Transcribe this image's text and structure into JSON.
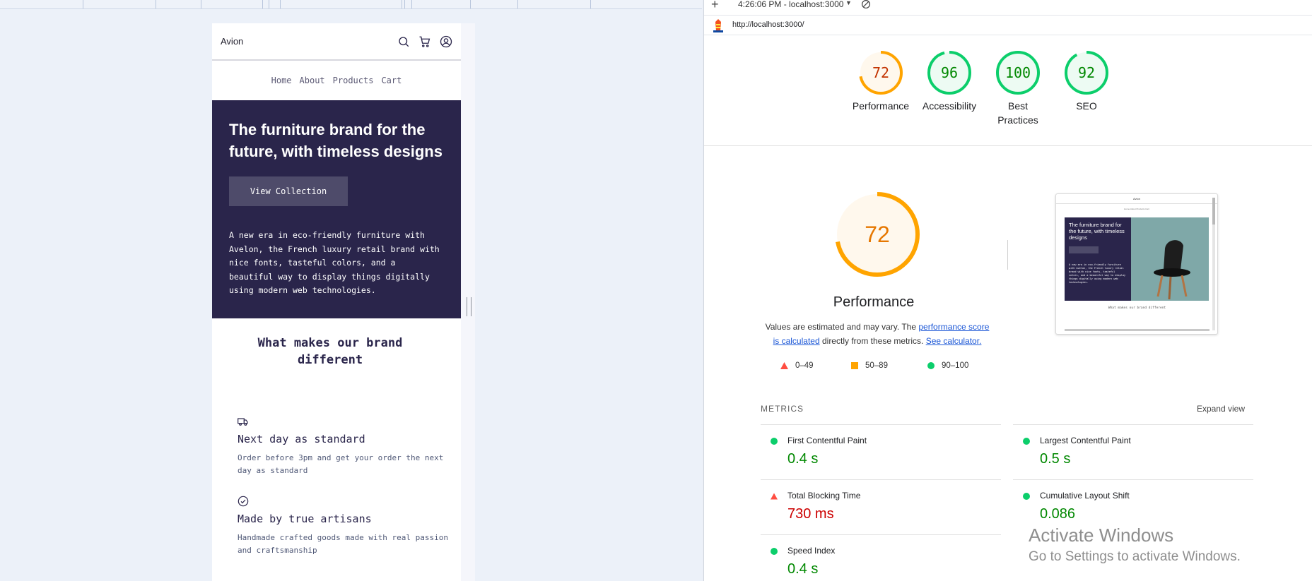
{
  "site": {
    "brand": "Avion",
    "nav": [
      "Home",
      "About",
      "Products",
      "Cart"
    ],
    "hero_title": "The furniture brand for the future, with timeless designs",
    "hero_button": "View Collection",
    "hero_text": "A new era in eco-friendly furniture with Avelon, the French luxury retail brand with nice fonts, tasteful colors, and a beautiful way to display things digitally using modern web technologies.",
    "section_title": "What makes our brand different",
    "features": [
      {
        "icon": "delivery-truck-icon",
        "title": "Next day as standard",
        "text": "Order before 3pm and get your order the next day as standard"
      },
      {
        "icon": "check-circle-icon",
        "title": "Made by true artisans",
        "text": "Handmade crafted goods made with real passion and craftsmanship"
      }
    ]
  },
  "lighthouse": {
    "report_label": "4:26:06 PM - localhost:3000",
    "url": "http://localhost:3000/",
    "categories": [
      {
        "label": "Performance",
        "score": 72,
        "status": "average"
      },
      {
        "label": "Accessibility",
        "score": 96,
        "status": "pass"
      },
      {
        "label": "Best Practices",
        "score": 100,
        "status": "pass"
      },
      {
        "label": "SEO",
        "score": 92,
        "status": "pass"
      }
    ],
    "performance": {
      "score": 72,
      "title": "Performance",
      "desc_pre": "Values are estimated and may vary. The ",
      "desc_link1": "performance score is calculated",
      "desc_mid": " directly from these metrics. ",
      "desc_link2": "See calculator."
    },
    "legend": [
      "0–49",
      "50–89",
      "90–100"
    ],
    "thumbnail": {
      "brand": "Avion",
      "nav": "Home About Products Cart",
      "title": "The furniture brand for the future, with timeless designs",
      "button": "View Collection",
      "text": "A new era in eco-friendly furniture with Avelon, the French luxury retail brand with nice fonts, tasteful colors, and a beautiful way to display things digitally using modern web technologies.",
      "caption": "What makes our brand different"
    },
    "metrics_title": "METRICS",
    "expand_view": "Expand view",
    "metrics": [
      {
        "name": "First Contentful Paint",
        "value": "0.4 s",
        "status": "pass"
      },
      {
        "name": "Largest Contentful Paint",
        "value": "0.5 s",
        "status": "pass"
      },
      {
        "name": "Total Blocking Time",
        "value": "730 ms",
        "status": "fail"
      },
      {
        "name": "Cumulative Layout Shift",
        "value": "0.086",
        "status": "pass"
      },
      {
        "name": "Speed Index",
        "value": "0.4 s",
        "status": "pass"
      }
    ]
  },
  "colors": {
    "pass": "#0cce6b",
    "pass_text": "#008800",
    "average": "#ffa400",
    "average_text": "#c33300",
    "fail": "#ff4e42",
    "fail_text": "#cc0000",
    "brand_dark": "#2a254b"
  },
  "watermark": {
    "line1": "Activate Windows",
    "line2": "Go to Settings to activate Windows."
  }
}
